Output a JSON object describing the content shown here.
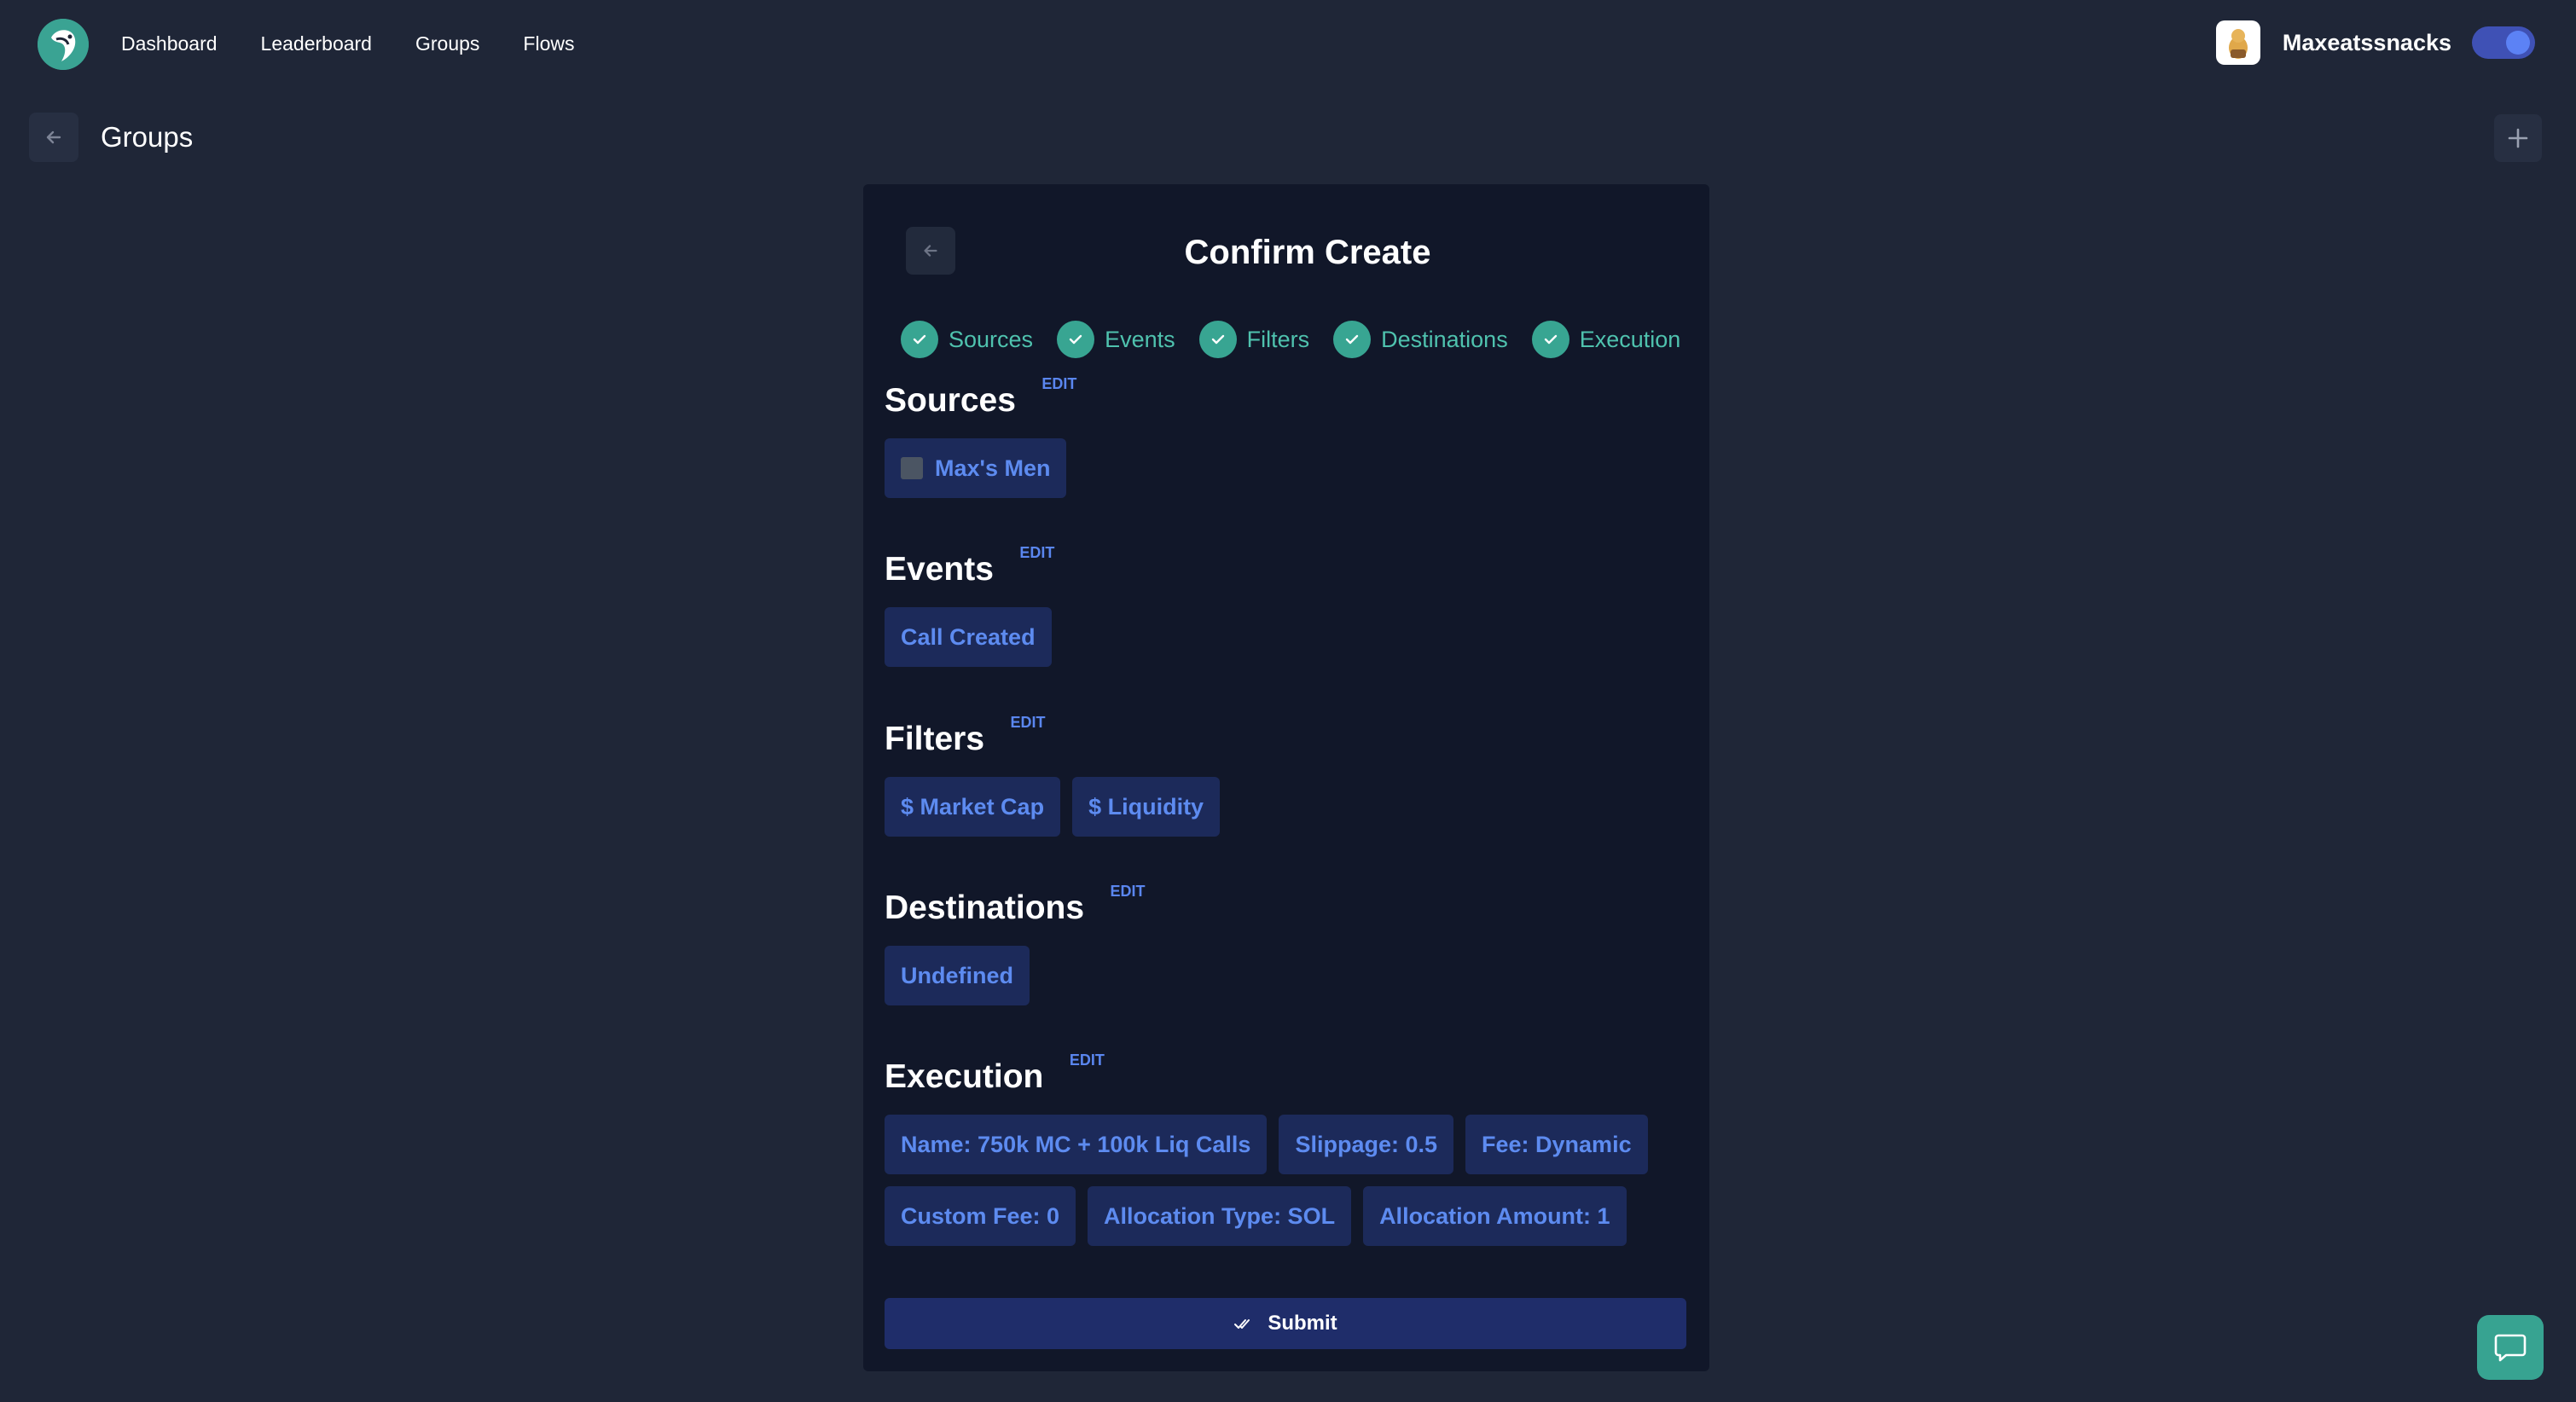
{
  "nav": {
    "items": [
      {
        "label": "Dashboard"
      },
      {
        "label": "Leaderboard"
      },
      {
        "label": "Groups"
      },
      {
        "label": "Flows"
      }
    ]
  },
  "user": {
    "name": "Maxeatssnacks",
    "theme_toggle_on": true
  },
  "page": {
    "title": "Groups",
    "back_icon": "arrow-left-icon",
    "add_icon": "plus-icon"
  },
  "card": {
    "title": "Confirm Create",
    "steps": [
      {
        "label": "Sources"
      },
      {
        "label": "Events"
      },
      {
        "label": "Filters"
      },
      {
        "label": "Destinations"
      },
      {
        "label": "Execution"
      }
    ],
    "edit_label": "EDIT",
    "sections": {
      "sources": {
        "title": "Sources",
        "chips": [
          "Max's Men"
        ]
      },
      "events": {
        "title": "Events",
        "chips": [
          "Call Created"
        ]
      },
      "filters": {
        "title": "Filters",
        "chips": [
          "$ Market Cap",
          "$ Liquidity"
        ]
      },
      "destinations": {
        "title": "Destinations",
        "chips": [
          "Undefined"
        ]
      },
      "execution": {
        "title": "Execution",
        "chips": [
          "Name: 750k MC + 100k Liq Calls",
          "Slippage: 0.5",
          "Fee: Dynamic",
          "Custom Fee: 0",
          "Allocation Type: SOL",
          "Allocation Amount: 1"
        ]
      }
    },
    "submit_label": "Submit"
  },
  "colors": {
    "background": "#1f2637",
    "card": "#111729",
    "accent_teal": "#38a592",
    "chip_bg": "#1c2a5a",
    "chip_text": "#5d8bf0"
  }
}
